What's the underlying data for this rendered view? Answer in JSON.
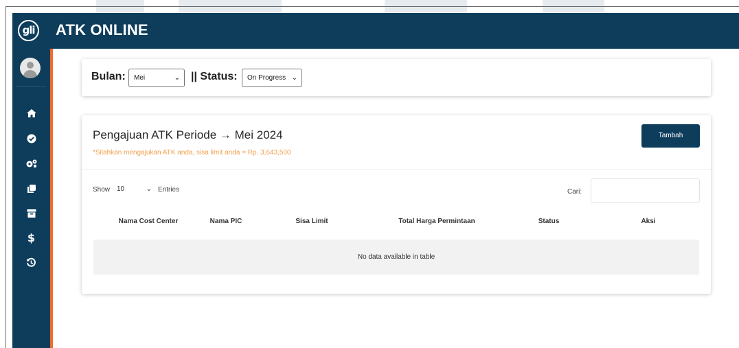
{
  "header": {
    "logo_text": "gli",
    "app_title": "ATK ONLINE"
  },
  "sidebar": {
    "items": [
      {
        "icon": "home-icon",
        "glyph": "⌂"
      },
      {
        "icon": "check-circle-icon",
        "glyph": "✔"
      },
      {
        "icon": "cogs-icon",
        "glyph": "⚙"
      },
      {
        "icon": "clone-icon",
        "glyph": "❐"
      },
      {
        "icon": "archive-icon",
        "glyph": "▤"
      },
      {
        "icon": "dollar-icon",
        "glyph": "$"
      },
      {
        "icon": "history-icon",
        "glyph": "↺"
      }
    ]
  },
  "filter": {
    "bulan_label": "Bulan:",
    "bulan_value": "Mei",
    "status_label": "|| Status:",
    "status_value": "On Progress"
  },
  "main": {
    "title": "Pengajuan ATK Periode → Mei 2024",
    "subtitle": "*Silahkan mengajukan ATK anda, sisa limit anda = Rp. 3,643,500",
    "add_button": "Tambah",
    "show_label": "Show",
    "entries_value": "10",
    "entries_label": "Entries",
    "search_label": "Cari:",
    "search_value": "",
    "columns": [
      "Nama Cost Center",
      "Nama PIC",
      "Sisa Limit",
      "Total Harga Permintaan",
      "Status",
      "Aksi"
    ],
    "empty_message": "No data available in table"
  },
  "colors": {
    "primary": "#0e3d5c",
    "accent": "#f26b2a",
    "notice": "#f0a04b"
  }
}
